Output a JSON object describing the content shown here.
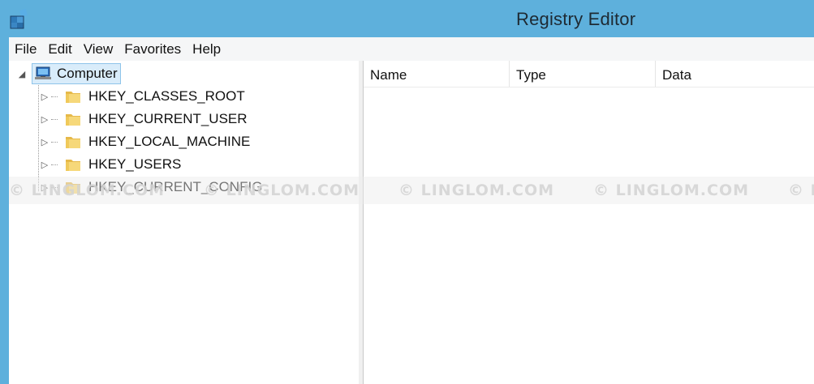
{
  "window": {
    "title": "Registry Editor",
    "app_icon": "registry-editor-icon"
  },
  "menu": [
    "File",
    "Edit",
    "View",
    "Favorites",
    "Help"
  ],
  "tree": {
    "root": {
      "label": "Computer",
      "icon": "computer-icon",
      "expanded": true,
      "selected": true
    },
    "children": [
      {
        "label": "HKEY_CLASSES_ROOT",
        "icon": "folder-icon"
      },
      {
        "label": "HKEY_CURRENT_USER",
        "icon": "folder-icon"
      },
      {
        "label": "HKEY_LOCAL_MACHINE",
        "icon": "folder-icon"
      },
      {
        "label": "HKEY_USERS",
        "icon": "folder-icon"
      },
      {
        "label": "HKEY_CURRENT_CONFIG",
        "icon": "folder-icon"
      }
    ]
  },
  "list": {
    "columns": [
      "Name",
      "Type",
      "Data"
    ]
  },
  "watermark": "© LINGLOM.COM",
  "colors": {
    "titlebar": "#5eb0dc",
    "selection": "#d9ecfa",
    "selection_border": "#8ec4ea",
    "folder": "#f3d26b"
  }
}
